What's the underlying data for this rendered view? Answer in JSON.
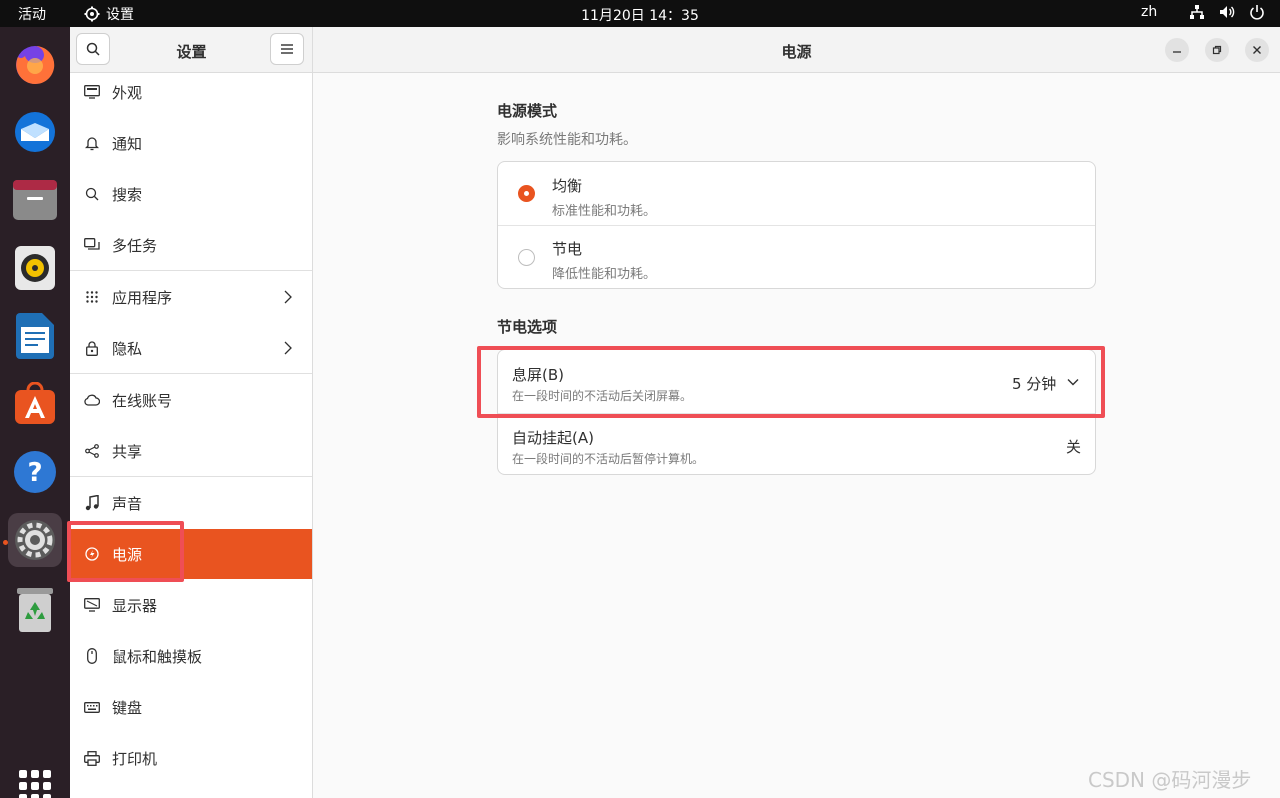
{
  "topbar": {
    "activities": "活动",
    "app_menu": "设置",
    "clock": "11月20日  14：35",
    "lang": "zh",
    "tray_icons": [
      "network-icon",
      "volume-icon",
      "power-icon"
    ]
  },
  "dock": {
    "items": [
      "firefox",
      "thunderbird",
      "files",
      "rhythmbox",
      "libreoffice-writer",
      "app-center",
      "help",
      "settings",
      "trash"
    ],
    "active": "settings"
  },
  "sidebar": {
    "title": "设置",
    "items": [
      {
        "label": "外观",
        "icon": "appearance-icon"
      },
      {
        "label": "通知",
        "icon": "bell-icon"
      },
      {
        "label": "搜索",
        "icon": "search-icon"
      },
      {
        "label": "多任务",
        "icon": "multitasking-icon"
      },
      {
        "label": "应用程序",
        "icon": "apps-grid-icon",
        "chevron": true
      },
      {
        "label": "隐私",
        "icon": "lock-icon",
        "chevron": true
      },
      {
        "label": "在线账号",
        "icon": "cloud-icon"
      },
      {
        "label": "共享",
        "icon": "share-icon"
      },
      {
        "label": "声音",
        "icon": "music-note-icon"
      },
      {
        "label": "电源",
        "icon": "power-icon",
        "active": true
      },
      {
        "label": "显示器",
        "icon": "display-icon"
      },
      {
        "label": "鼠标和触摸板",
        "icon": "mouse-icon"
      },
      {
        "label": "键盘",
        "icon": "keyboard-icon"
      },
      {
        "label": "打印机",
        "icon": "printer-icon"
      }
    ]
  },
  "main": {
    "title": "电源",
    "power_mode": {
      "title": "电源模式",
      "subtitle": "影响系统性能和功耗。",
      "options": [
        {
          "label": "均衡",
          "desc": "标准性能和功耗。",
          "selected": true
        },
        {
          "label": "节电",
          "desc": "降低性能和功耗。",
          "selected": false
        }
      ]
    },
    "power_saving": {
      "title": "节电选项",
      "rows": [
        {
          "label": "息屏(B)",
          "desc": "在一段时间的不活动后关闭屏幕。",
          "value": "5 分钟"
        },
        {
          "label": "自动挂起(A)",
          "desc": "在一段时间的不活动后暂停计算机。",
          "value": "关"
        }
      ]
    }
  },
  "watermark": "CSDN @码河漫步",
  "colors": {
    "accent": "#e95420",
    "highlight": "#ef4e55",
    "dock_bg": "#2a1f26"
  }
}
